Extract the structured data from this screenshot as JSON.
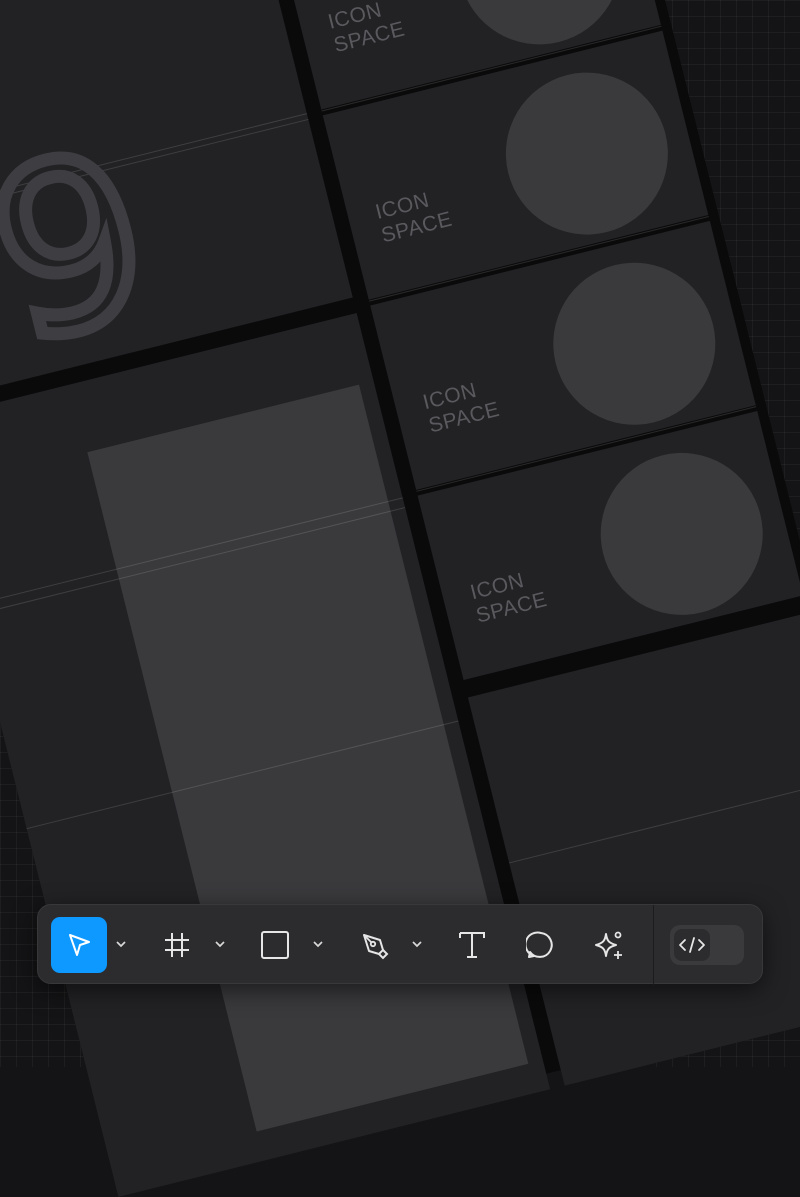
{
  "canvas": {
    "icon_cards": [
      {
        "label_line1": "ICON",
        "label_line2": "SPACE"
      },
      {
        "label_line1": "ICON",
        "label_line2": "SPACE"
      },
      {
        "label_line1": "ICON",
        "label_line2": "SPACE"
      },
      {
        "label_line1": "ICON",
        "label_line2": "SPACE"
      }
    ],
    "big_digit": "9"
  },
  "toolbar": {
    "tools": [
      {
        "name": "move",
        "icon": "pointer-icon",
        "active": true,
        "has_dropdown": true
      },
      {
        "name": "frame",
        "icon": "hash-frame-icon",
        "active": false,
        "has_dropdown": true
      },
      {
        "name": "shape",
        "icon": "square-icon",
        "active": false,
        "has_dropdown": true
      },
      {
        "name": "pen",
        "icon": "pen-icon",
        "active": false,
        "has_dropdown": true
      },
      {
        "name": "text",
        "icon": "text-icon",
        "active": false,
        "has_dropdown": false
      },
      {
        "name": "comment",
        "icon": "comment-icon",
        "active": false,
        "has_dropdown": false
      },
      {
        "name": "ai",
        "icon": "sparkle-icon",
        "active": false,
        "has_dropdown": false
      }
    ],
    "dev_mode_icon": "code-icon",
    "accent_color": "#0d99ff"
  }
}
